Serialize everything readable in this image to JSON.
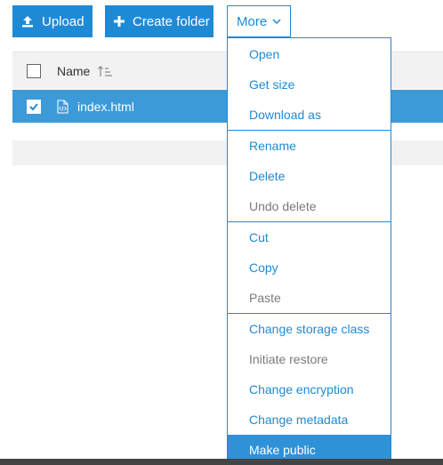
{
  "toolbar": {
    "upload_label": "Upload",
    "create_folder_label": "Create folder",
    "more_label": "More"
  },
  "table": {
    "header_name": "Name",
    "rows": [
      {
        "name": "index.html",
        "selected": true
      }
    ]
  },
  "more_menu": {
    "group1": [
      "Open",
      "Get size",
      "Download as"
    ],
    "group2": [
      "Rename",
      "Delete",
      "Undo delete"
    ],
    "group3": [
      "Cut",
      "Copy",
      "Paste"
    ],
    "group4": [
      "Change storage class",
      "Initiate restore",
      "Change encryption",
      "Change metadata",
      "Make public"
    ]
  },
  "colors": {
    "accent": "#1e8ad6",
    "selected_row": "#3d9ad8",
    "menu_highlight": "#2f92d8",
    "disabled_text": "#7a7a7a"
  },
  "icons": {
    "upload": "upload-icon",
    "create_folder": "plus-icon",
    "more": "chevron-down-icon",
    "sort": "sort-ascending-icon",
    "file": "html-file-icon",
    "checkbox": "check-icon"
  }
}
